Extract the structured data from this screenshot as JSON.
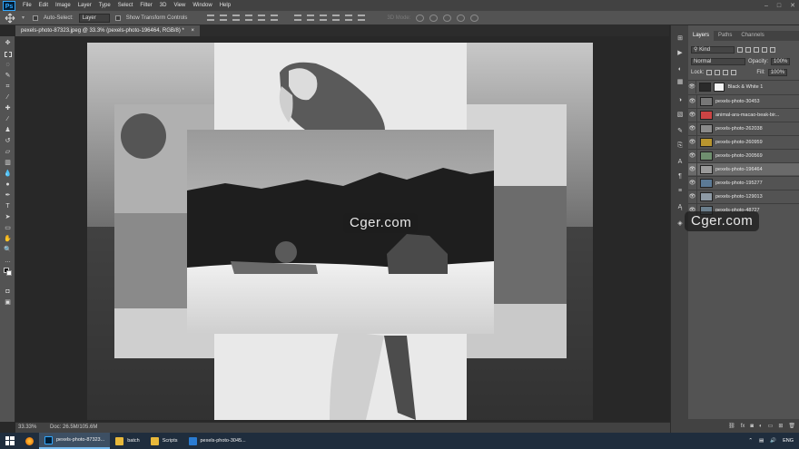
{
  "menubar": {
    "logo": "Ps",
    "items": [
      "File",
      "Edit",
      "Image",
      "Layer",
      "Type",
      "Select",
      "Filter",
      "3D",
      "View",
      "Window",
      "Help"
    ],
    "controls": [
      "–",
      "□",
      "✕"
    ]
  },
  "options": {
    "auto_select_label": "Auto-Select:",
    "auto_select_value": "Layer",
    "transform_label": "Show Transform Controls",
    "mode_3d_label": "3D Mode:"
  },
  "document": {
    "tab_title": "pexels-photo-87323.jpeg @ 33.3% (pexels-photo-196464, RGB/8) *",
    "tab_close": "×"
  },
  "status": {
    "zoom": "33.33%",
    "doc": "Doc: 26.5M/105.6M"
  },
  "layers_panel": {
    "tabs": [
      "Layers",
      "Paths",
      "Channels"
    ],
    "kind_label": "Kind",
    "blend_mode": "Normal",
    "opacity_label": "Opacity:",
    "opacity_value": "100%",
    "lock_label": "Lock:",
    "fill_label": "Fill:",
    "fill_value": "100%",
    "layers": [
      {
        "name": "Black & White 1",
        "selected": false
      },
      {
        "name": "pexels-photo-30453",
        "selected": false
      },
      {
        "name": "animal-ara-macao-beak-bir...",
        "selected": false
      },
      {
        "name": "pexels-photo-262038",
        "selected": false
      },
      {
        "name": "pexels-photo-260959",
        "selected": false
      },
      {
        "name": "pexels-photo-200569",
        "selected": false
      },
      {
        "name": "pexels-photo-196464",
        "selected": true
      },
      {
        "name": "pexels-photo-195277",
        "selected": false
      },
      {
        "name": "pexels-photo-129013",
        "selected": false
      },
      {
        "name": "pexels-photo-48727",
        "selected": false
      }
    ],
    "bottom_icons": [
      "link-icon",
      "fx-icon",
      "mask-icon",
      "adjustment-icon",
      "group-icon",
      "new-layer-icon",
      "trash-icon"
    ],
    "fx_label": "fx"
  },
  "watermark": {
    "text": "Cger.com"
  },
  "taskbar": {
    "items": [
      {
        "label": "pexels-photo-87323...",
        "active": true
      },
      {
        "label": "batch",
        "active": false
      },
      {
        "label": "Scripts",
        "active": false
      },
      {
        "label": "pexels-photo-3045...",
        "active": false
      }
    ],
    "tray_lang": "ENG"
  },
  "colors": {
    "ps_blue": "#31a8ff",
    "panel_gray": "#535353",
    "canvas_bg": "#282828",
    "taskbar_bg": "#1f2d3d"
  }
}
